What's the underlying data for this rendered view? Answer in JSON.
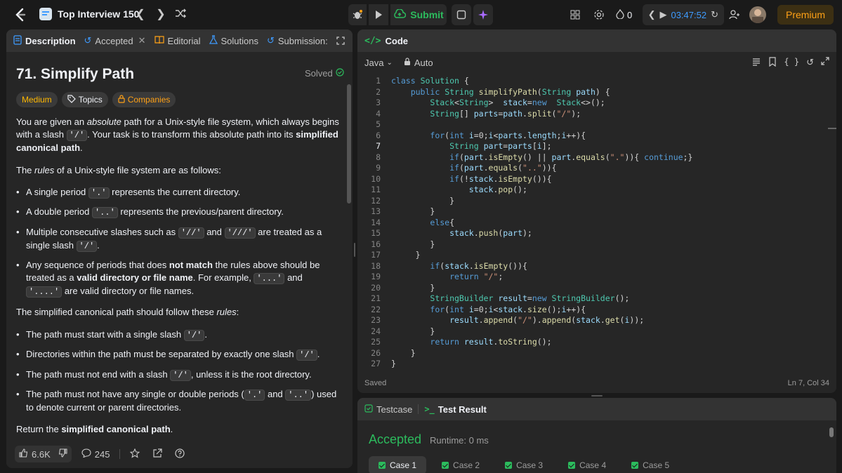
{
  "topnav": {
    "list_title": "Top Interview 150",
    "submit_label": "Submit",
    "streak_count": "0",
    "timer": "03:47:52",
    "premium_label": "Premium"
  },
  "desc_tabs": {
    "description": "Description",
    "accepted": "Accepted",
    "editorial": "Editorial",
    "solutions": "Solutions",
    "submissions": "Submission:"
  },
  "problem": {
    "title": "71. Simplify Path",
    "solved_label": "Solved",
    "difficulty": "Medium",
    "topics_label": "Topics",
    "companies_label": "Companies",
    "p1_a": "You are given an ",
    "p1_b": "absolute",
    "p1_c": " path for a Unix-style file system, which always begins with a slash ",
    "p1_code": "'/'",
    "p1_d": ". Your task is to transform this absolute path into its ",
    "p1_e": "simplified canonical path",
    "p1_f": ".",
    "p2_a": "The ",
    "p2_b": "rules",
    "p2_c": " of a Unix-style file system are as follows:",
    "r1_a": "A single period ",
    "r1_code": "'.'",
    "r1_b": " represents the current directory.",
    "r2_a": "A double period ",
    "r2_code": "'..'",
    "r2_b": " represents the previous/parent directory.",
    "r3_a": "Multiple consecutive slashes such as ",
    "r3_code1": "'//'",
    "r3_b": " and ",
    "r3_code2": "'///'",
    "r3_c": " are treated as a single slash ",
    "r3_code3": "'/'",
    "r3_d": ".",
    "r4_a": "Any sequence of periods that does ",
    "r4_b": "not match",
    "r4_c": " the rules above should be treated as a ",
    "r4_d": "valid directory or file name",
    "r4_e": ". For example, ",
    "r4_code1": "'...'",
    "r4_f": " and ",
    "r4_code2": "'....'",
    "r4_g": " are valid directory or file names.",
    "p3_a": "The simplified canonical path should follow these ",
    "p3_b": "rules",
    "p3_c": ":",
    "s1_a": "The path must start with a single slash ",
    "s1_code": "'/'",
    "s1_b": ".",
    "s2_a": "Directories within the path must be separated by exactly one slash ",
    "s2_code": "'/'",
    "s2_b": ".",
    "s3_a": "The path must not end with a slash ",
    "s3_code": "'/'",
    "s3_b": ", unless it is the root directory.",
    "s4_a": "The path must not have any single or double periods (",
    "s4_code1": "'.'",
    "s4_b": " and ",
    "s4_code2": "'..'",
    "s4_c": ") used to denote current or parent directories.",
    "p4_a": "Return the ",
    "p4_b": "simplified canonical path",
    "p4_c": "."
  },
  "desc_footer": {
    "likes": "6.6K",
    "comments": "245"
  },
  "code_panel": {
    "title": "Code",
    "language": "Java",
    "mode": "Auto",
    "status_saved": "Saved",
    "cursor_pos": "Ln 7, Col 34"
  },
  "code_lines": [
    {
      "n": "1",
      "t": "class Solution {"
    },
    {
      "n": "2",
      "t": "    public String simplifyPath(String path) {"
    },
    {
      "n": "3",
      "t": "        Stack<String>  stack=new  Stack<>();"
    },
    {
      "n": "4",
      "t": "        String[] parts=path.split(\"/\");"
    },
    {
      "n": "5",
      "t": ""
    },
    {
      "n": "6",
      "t": "        for(int i=0;i<parts.length;i++){"
    },
    {
      "n": "7",
      "t": "            String part=parts[i];"
    },
    {
      "n": "8",
      "t": "            if(part.isEmpty() || part.equals(\".\")){ continue;}"
    },
    {
      "n": "9",
      "t": "            if(part.equals(\"..\")){"
    },
    {
      "n": "10",
      "t": "            if(!stack.isEmpty()){"
    },
    {
      "n": "11",
      "t": "                stack.pop();"
    },
    {
      "n": "12",
      "t": "            }"
    },
    {
      "n": "13",
      "t": "        }"
    },
    {
      "n": "14",
      "t": "        else{"
    },
    {
      "n": "15",
      "t": "            stack.push(part);"
    },
    {
      "n": "16",
      "t": "        }"
    },
    {
      "n": "17",
      "t": "     }"
    },
    {
      "n": "18",
      "t": "        if(stack.isEmpty()){"
    },
    {
      "n": "19",
      "t": "            return \"/\";"
    },
    {
      "n": "20",
      "t": "        }"
    },
    {
      "n": "21",
      "t": "        StringBuilder result=new StringBuilder();"
    },
    {
      "n": "22",
      "t": "        for(int i=0;i<stack.size();i++){"
    },
    {
      "n": "23",
      "t": "            result.append(\"/\").append(stack.get(i));"
    },
    {
      "n": "24",
      "t": "        }"
    },
    {
      "n": "25",
      "t": "        return result.toString();"
    },
    {
      "n": "26",
      "t": "    }"
    },
    {
      "n": "27",
      "t": "}"
    }
  ],
  "result_panel": {
    "testcase_tab": "Testcase",
    "result_tab": "Test Result",
    "status": "Accepted",
    "runtime": "Runtime: 0 ms",
    "cases": [
      "Case 1",
      "Case 2",
      "Case 3",
      "Case 4",
      "Case 5"
    ]
  },
  "colors": {
    "accent_orange": "#ffa116",
    "accepted_green": "#2cbb5d",
    "medium_yellow": "#ffb800",
    "timer_blue": "#3e9bff"
  }
}
